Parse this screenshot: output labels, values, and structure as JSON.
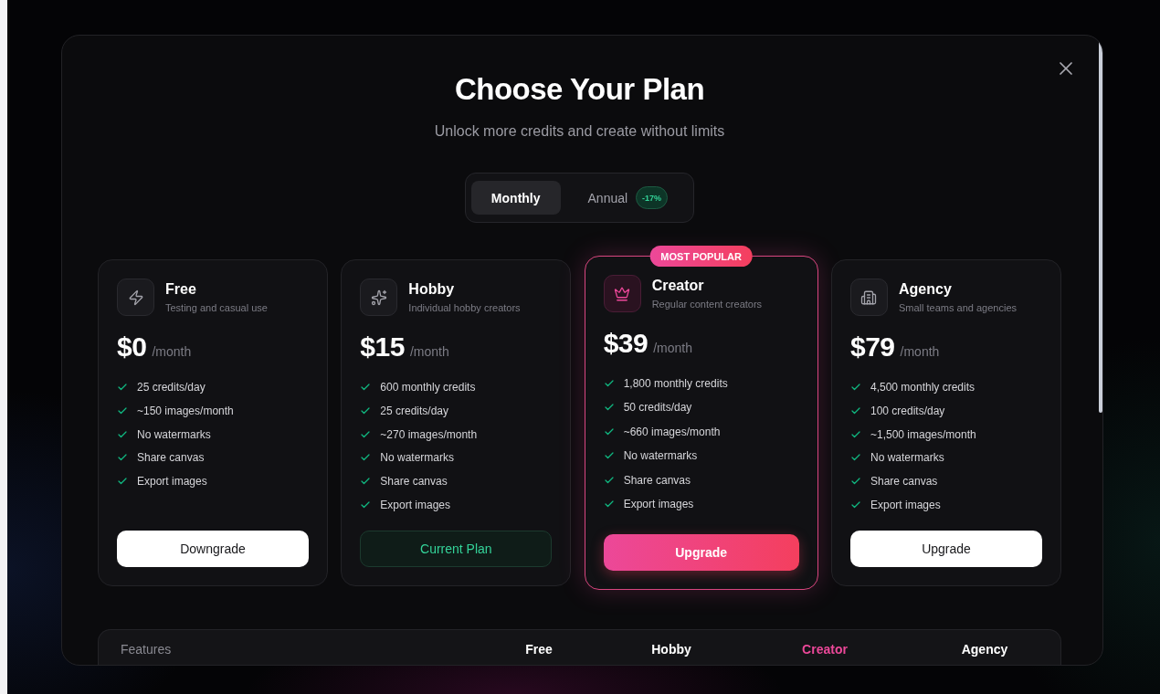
{
  "dialog": {
    "title": "Choose Your Plan",
    "subtitle": "Unlock more credits and create without limits"
  },
  "billing_toggle": [
    {
      "label": "Monthly",
      "selected": true
    },
    {
      "label": "Annual",
      "selected": false,
      "badge": "-17%"
    }
  ],
  "plans": [
    {
      "name": "Free",
      "description": "Testing and casual use",
      "price": "$0",
      "period": "/month",
      "highlighted": false,
      "features": [
        "25 credits/day",
        "~150 images/month",
        "No watermarks",
        "Share canvas",
        "Export images"
      ],
      "button": {
        "label": "Downgrade",
        "kind": "light"
      }
    },
    {
      "name": "Hobby",
      "description": "Individual hobby creators",
      "price": "$15",
      "period": "/month",
      "highlighted": false,
      "features": [
        "600 monthly credits",
        "25 credits/day",
        "~270 images/month",
        "No watermarks",
        "Share canvas",
        "Export images"
      ],
      "button": {
        "label": "Current Plan",
        "kind": "current"
      }
    },
    {
      "name": "Creator",
      "description": "Regular content creators",
      "price": "$39",
      "period": "/month",
      "highlighted": true,
      "badge": "MOST POPULAR",
      "features": [
        "1,800 monthly credits",
        "50 credits/day",
        "~660 images/month",
        "No watermarks",
        "Share canvas",
        "Export images"
      ],
      "button": {
        "label": "Upgrade",
        "kind": "accent"
      }
    },
    {
      "name": "Agency",
      "description": "Small teams and agencies",
      "price": "$79",
      "period": "/month",
      "highlighted": false,
      "features": [
        "4,500 monthly credits",
        "100 credits/day",
        "~1,500 images/month",
        "No watermarks",
        "Share canvas",
        "Export images"
      ],
      "button": {
        "label": "Upgrade",
        "kind": "light"
      }
    }
  ],
  "features_table": {
    "heading": "Features",
    "columns": [
      {
        "label": "Free",
        "highlighted": false
      },
      {
        "label": "Hobby",
        "highlighted": false
      },
      {
        "label": "Creator",
        "highlighted": true
      },
      {
        "label": "Agency",
        "highlighted": false
      }
    ]
  }
}
